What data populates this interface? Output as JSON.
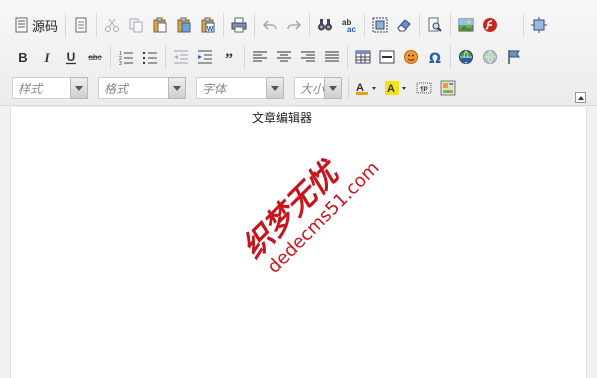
{
  "toolbar": {
    "source_label": "源码"
  },
  "combos": [
    {
      "placeholder": "样式"
    },
    {
      "placeholder": "格式"
    },
    {
      "placeholder": "字体"
    },
    {
      "placeholder": "大小"
    }
  ],
  "content": {
    "text": "文章编辑器"
  },
  "watermark": {
    "line1": "织梦无忧",
    "line2": "dedecms51.com"
  },
  "colors": {
    "watermark": "#c8141e"
  }
}
